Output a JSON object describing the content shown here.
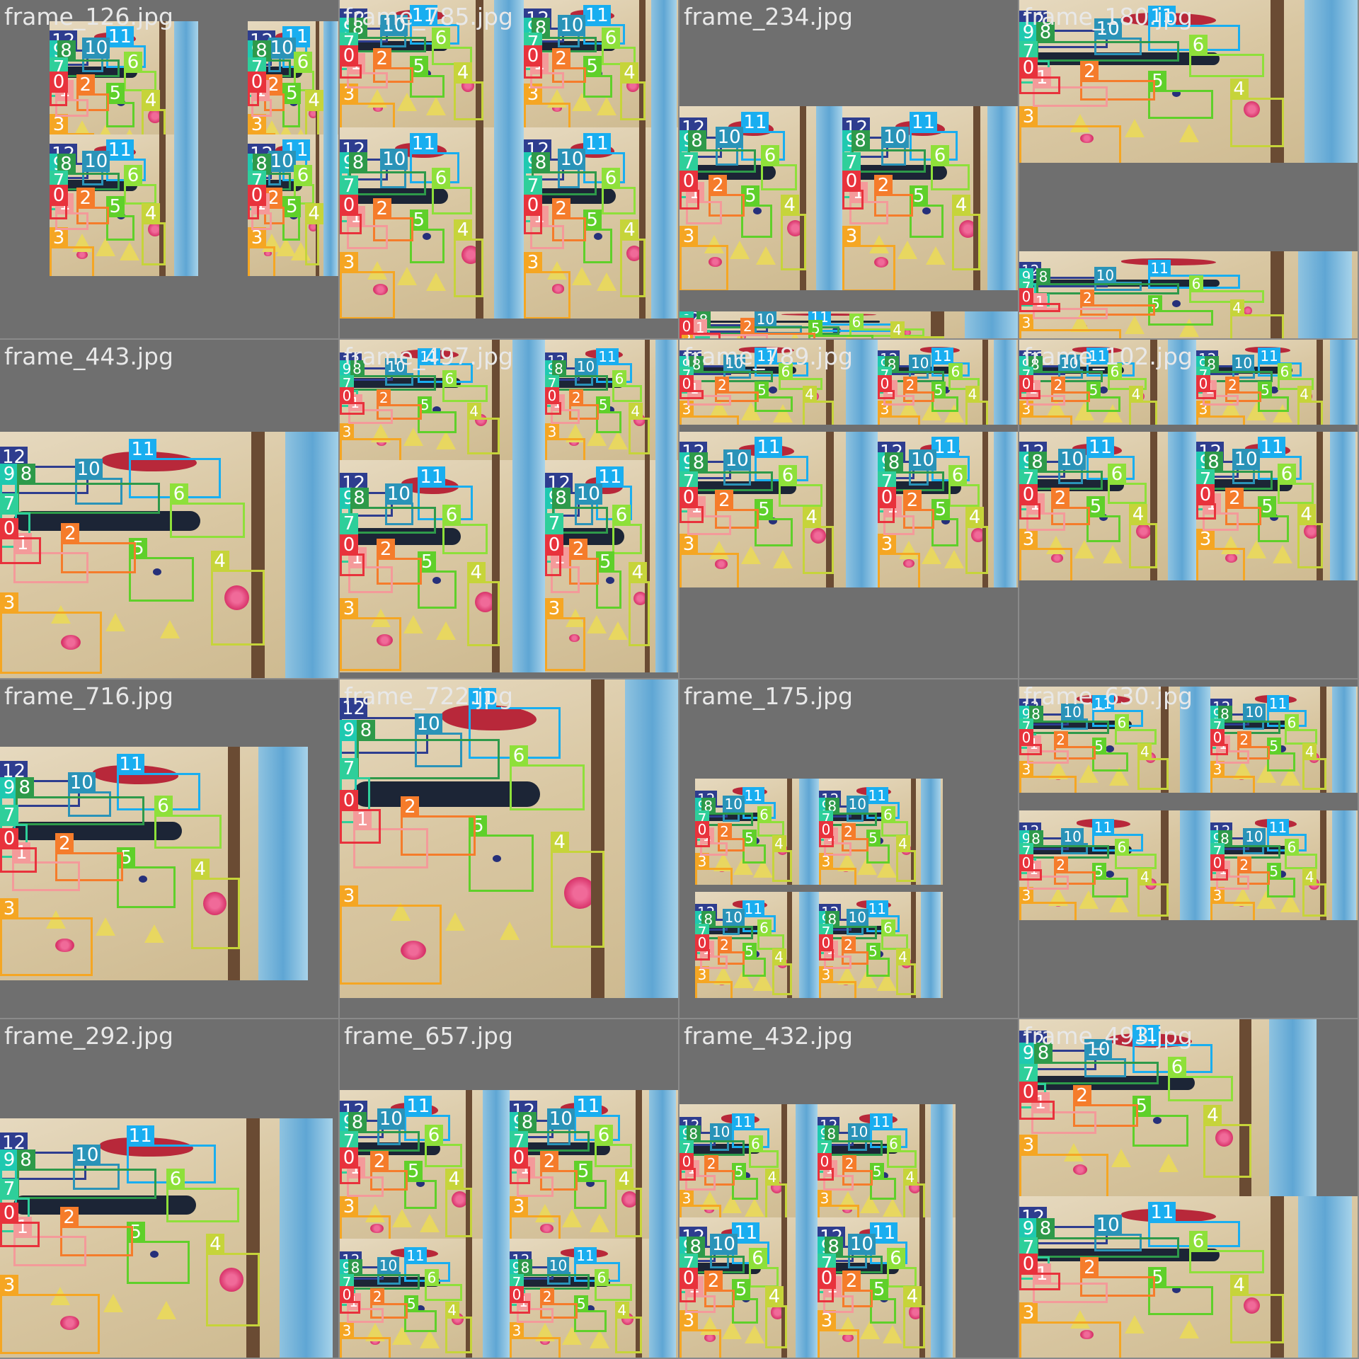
{
  "colors": {
    "0": "#e8323c",
    "1": "#f49a9a",
    "2": "#f57c2b",
    "3": "#f5a623",
    "4": "#c6d43a",
    "5": "#5fd02a",
    "6": "#8ee03a",
    "7": "#2ecf9a",
    "8": "#2e9a4a",
    "9": "#1fc9b0",
    "10": "#2a93b8",
    "11": "#19aef0",
    "12": "#2e3d8f"
  },
  "tiles": [
    {
      "title": "frame_126.jpg",
      "mosaic": true
    },
    {
      "title": "frame_785.jpg",
      "mosaic": true
    },
    {
      "title": "frame_234.jpg",
      "mosaic": true
    },
    {
      "title": "frame_180.jpg",
      "mosaic": true
    },
    {
      "title": "frame_443.jpg",
      "mosaic": false
    },
    {
      "title": "frame_497.jpg",
      "mosaic": true
    },
    {
      "title": "frame_789.jpg",
      "mosaic": true
    },
    {
      "title": "frame_102.jpg",
      "mosaic": true
    },
    {
      "title": "frame_716.jpg",
      "mosaic": false
    },
    {
      "title": "frame_722.jpg",
      "mosaic": false
    },
    {
      "title": "frame_175.jpg",
      "mosaic": true
    },
    {
      "title": "frame_630.jpg",
      "mosaic": true
    },
    {
      "title": "frame_292.jpg",
      "mosaic": false
    },
    {
      "title": "frame_657.jpg",
      "mosaic": true
    },
    {
      "title": "frame_432.jpg",
      "mosaic": true
    },
    {
      "title": "frame_493.jpg",
      "mosaic": true
    }
  ],
  "detections": [
    "12",
    "11",
    "10",
    "9",
    "8",
    "7",
    "6",
    "5",
    "4",
    "3",
    "2",
    "1",
    "0"
  ]
}
